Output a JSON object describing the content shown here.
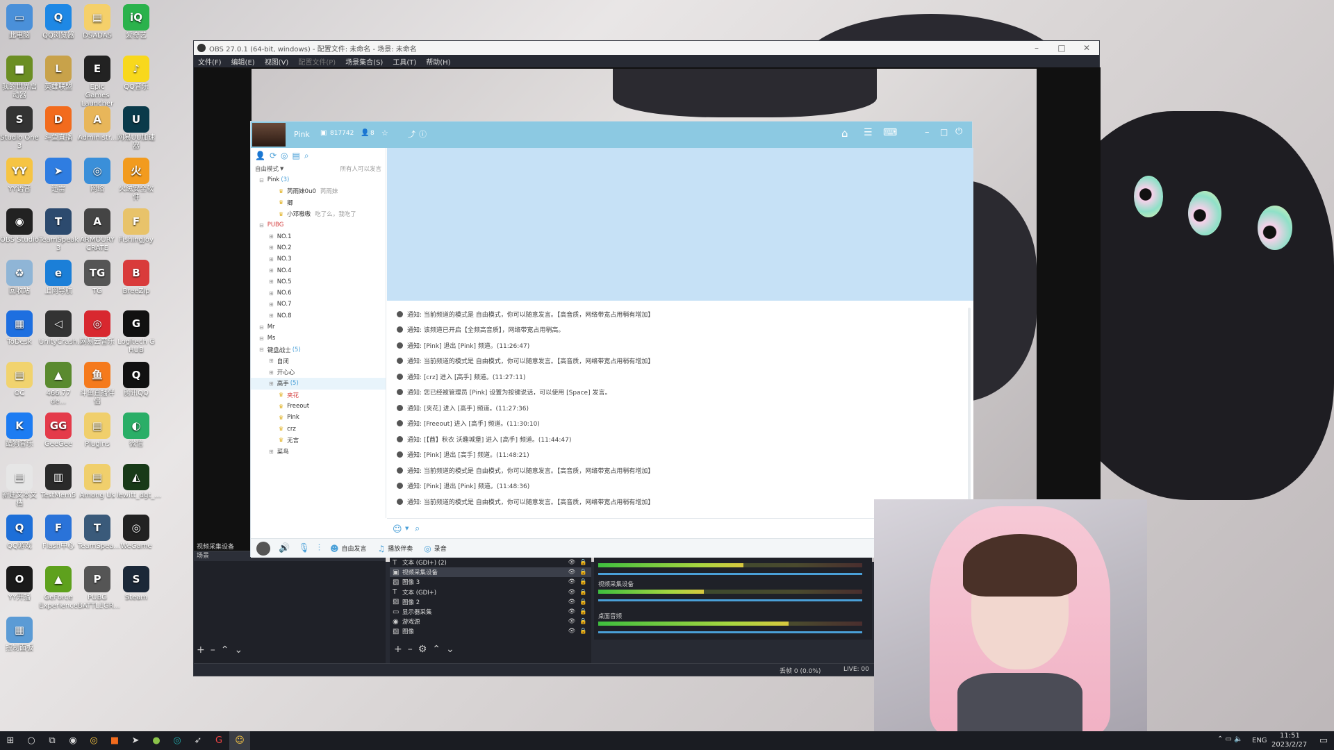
{
  "desktop_icons": [
    {
      "label": "此电脑",
      "color": "#4a90d9",
      "glyph": "▭"
    },
    {
      "label": "QQ浏览器",
      "color": "#1e88e5",
      "glyph": "Q"
    },
    {
      "label": "DSADAS",
      "color": "#f5d06a",
      "glyph": "▤"
    },
    {
      "label": "爱奇艺",
      "color": "#2bb24c",
      "glyph": "iQ"
    },
    {
      "label": "我的世界启动器",
      "color": "#6b8e23",
      "glyph": "■"
    },
    {
      "label": "英雄联盟",
      "color": "#c8a24a",
      "glyph": "L"
    },
    {
      "label": "Epic Games Launcher",
      "color": "#222",
      "glyph": "E"
    },
    {
      "label": "QQ音乐",
      "color": "#f8d81c",
      "glyph": "♪"
    },
    {
      "label": "Studio One 3",
      "color": "#333",
      "glyph": "S"
    },
    {
      "label": "斗鱼直播",
      "color": "#f26b1d",
      "glyph": "D"
    },
    {
      "label": "Administr...",
      "color": "#e8b65a",
      "glyph": "A"
    },
    {
      "label": "网易UU加速器",
      "color": "#0a3a4a",
      "glyph": "U"
    },
    {
      "label": "YY语音",
      "color": "#f6c443",
      "glyph": "YY"
    },
    {
      "label": "迅雷",
      "color": "#2f7de1",
      "glyph": "➤"
    },
    {
      "label": "网络",
      "color": "#3a8fd9",
      "glyph": "◎"
    },
    {
      "label": "火绒安全软件",
      "color": "#f29b1e",
      "glyph": "火"
    },
    {
      "label": "OBS Studio",
      "color": "#222",
      "glyph": "◉"
    },
    {
      "label": "TeamSpeak 3",
      "color": "#2c4a6e",
      "glyph": "T"
    },
    {
      "label": "ARMOURY CRATE",
      "color": "#444",
      "glyph": "A"
    },
    {
      "label": "FishingJoy",
      "color": "#e8c36a",
      "glyph": "F"
    },
    {
      "label": "回收站",
      "color": "#8fb5d6",
      "glyph": "♻"
    },
    {
      "label": "上网导航",
      "color": "#1b7fd8",
      "glyph": "e"
    },
    {
      "label": "TG",
      "color": "#555",
      "glyph": "TG"
    },
    {
      "label": "BreeZip",
      "color": "#d93b3b",
      "glyph": "B"
    },
    {
      "label": "ToDesk",
      "color": "#1e6fe0",
      "glyph": "▦"
    },
    {
      "label": "UnityCrash...",
      "color": "#333",
      "glyph": "◁"
    },
    {
      "label": "网易云音乐",
      "color": "#d8282f",
      "glyph": "◎"
    },
    {
      "label": "Logitech G HUB",
      "color": "#111",
      "glyph": "G"
    },
    {
      "label": "OC",
      "color": "#f1d36e",
      "glyph": "▤"
    },
    {
      "label": "466.77 de...",
      "color": "#5a8a2f",
      "glyph": "▲"
    },
    {
      "label": "斗鱼直播伴侣",
      "color": "#f57a1c",
      "glyph": "鱼"
    },
    {
      "label": "腾讯QQ",
      "color": "#111",
      "glyph": "Q"
    },
    {
      "label": "酷狗音乐",
      "color": "#1d7cf2",
      "glyph": "K"
    },
    {
      "label": "GeeGee",
      "color": "#e43b4a",
      "glyph": "GG"
    },
    {
      "label": "Plugins",
      "color": "#f0cf6c",
      "glyph": "▤"
    },
    {
      "label": "微信",
      "color": "#2aae67",
      "glyph": "◐"
    },
    {
      "label": "新建文本文档",
      "color": "#e6e6e6",
      "glyph": "▤"
    },
    {
      "label": "TestMem5",
      "color": "#2a2a2a",
      "glyph": "▥"
    },
    {
      "label": "Among Us",
      "color": "#f0cf6c",
      "glyph": "▤"
    },
    {
      "label": "lewitt_dgt_...",
      "color": "#183a18",
      "glyph": "◭"
    },
    {
      "label": "QQ游戏",
      "color": "#1d6fd8",
      "glyph": "Q"
    },
    {
      "label": "Flash中心",
      "color": "#2a73d9",
      "glyph": "F"
    },
    {
      "label": "TeamSpea...",
      "color": "#3a5a7a",
      "glyph": "T"
    },
    {
      "label": "WeGame",
      "color": "#222",
      "glyph": "◎"
    },
    {
      "label": "YY开播",
      "color": "#1a1a1a",
      "glyph": "O"
    },
    {
      "label": "GeForce Experience",
      "color": "#5ea11d",
      "glyph": "▲"
    },
    {
      "label": "PUBG BATTLEGR...",
      "color": "#555",
      "glyph": "P"
    },
    {
      "label": "Steam",
      "color": "#1b2838",
      "glyph": "S"
    },
    {
      "label": "控制面板",
      "color": "#5b9bd5",
      "glyph": "▦"
    }
  ],
  "obs": {
    "title": "OBS 27.0.1 (64-bit, windows) - 配置文件: 未命名 - 场景: 未命名",
    "menu": [
      {
        "label": "文件(F)",
        "dim": false
      },
      {
        "label": "编辑(E)",
        "dim": false
      },
      {
        "label": "视图(V)",
        "dim": false
      },
      {
        "label": "配置文件(P)",
        "dim": true
      },
      {
        "label": "场景集合(S)",
        "dim": false
      },
      {
        "label": "工具(T)",
        "dim": false
      },
      {
        "label": "帮助(H)",
        "dim": false
      }
    ],
    "source_label": "视频采集设备",
    "scenes_header": "场景",
    "sources": [
      {
        "icon": "T",
        "label": "文本 (GDI+) (2)"
      },
      {
        "icon": "▣",
        "label": "视频采集设备"
      },
      {
        "icon": "▨",
        "label": "图像 3"
      },
      {
        "icon": "T",
        "label": "文本 (GDI+)"
      },
      {
        "icon": "▨",
        "label": "图像 2"
      },
      {
        "icon": "▭",
        "label": "显示器采集"
      },
      {
        "icon": "◉",
        "label": "游戏源"
      },
      {
        "icon": "▨",
        "label": "图像"
      }
    ],
    "mixer": [
      {
        "name": "视频采集设备",
        "level": 0.4
      },
      {
        "name": "桌面音频",
        "level": 0.72
      }
    ],
    "status": "丢帧 0 (0.0%)",
    "live": "LIVE: 00"
  },
  "yy": {
    "channel_name": "Pink",
    "channel_id": "817742",
    "online": "8",
    "mode": "自由模式",
    "mode_note": "所有人可以发言",
    "tree": [
      {
        "level": 0,
        "text": "Pink",
        "count": "(3)",
        "color": "#333"
      },
      {
        "level": 2,
        "text": "芮雨妹0u0",
        "extra": "芮雨妹",
        "color": "#333"
      },
      {
        "level": 2,
        "text": "卿",
        "extra": "",
        "color": "#333"
      },
      {
        "level": 2,
        "text": "小邓嗷嗷",
        "extra": "吃了么，我吃了",
        "color": "#333"
      },
      {
        "level": 0,
        "text": "PUBG",
        "count": "",
        "color": "#d43c3c"
      },
      {
        "level": 1,
        "text": "NO.1",
        "count": "",
        "color": "#333"
      },
      {
        "level": 1,
        "text": "NO.2",
        "count": "",
        "color": "#333"
      },
      {
        "level": 1,
        "text": "NO.3",
        "count": "",
        "color": "#333"
      },
      {
        "level": 1,
        "text": "NO.4",
        "count": "",
        "color": "#333"
      },
      {
        "level": 1,
        "text": "NO.5",
        "count": "",
        "color": "#333"
      },
      {
        "level": 1,
        "text": "NO.6",
        "count": "",
        "color": "#333"
      },
      {
        "level": 1,
        "text": "NO.7",
        "count": "",
        "color": "#333"
      },
      {
        "level": 1,
        "text": "NO.8",
        "count": "",
        "color": "#333"
      },
      {
        "level": 0,
        "text": "Mr",
        "count": "",
        "color": "#333"
      },
      {
        "level": 0,
        "text": "Ms",
        "count": "",
        "color": "#333"
      },
      {
        "level": 0,
        "text": "键盘战士",
        "count": "(5)",
        "color": "#333"
      },
      {
        "level": 1,
        "text": "自闭",
        "count": "",
        "color": "#333"
      },
      {
        "level": 1,
        "text": "开心心",
        "count": "",
        "color": "#333"
      },
      {
        "level": 1,
        "text": "高手",
        "count": "(5)",
        "color": "#333",
        "selected": true
      },
      {
        "level": 2,
        "text": "夹花",
        "extra": "",
        "color": "#d43c3c"
      },
      {
        "level": 2,
        "text": "Freeout",
        "extra": "",
        "color": "#333"
      },
      {
        "level": 2,
        "text": "Pink",
        "extra": "",
        "color": "#333"
      },
      {
        "level": 2,
        "text": "crz",
        "extra": "",
        "color": "#333"
      },
      {
        "level": 2,
        "text": "无言",
        "extra": "",
        "color": "#333"
      },
      {
        "level": 1,
        "text": "菜鸟",
        "count": "",
        "color": "#333"
      }
    ],
    "messages": [
      "通知: 当前频道的模式是 自由模式，你可以随意发言。【高音质，网络带宽占用稍有增加】",
      "通知: 该频道已开启【全频高音质】，网络带宽占用稍高。",
      "通知: [Pink] 退出 [Pink] 频道。(11:26:47)",
      "通知: 当前频道的模式是 自由模式，你可以随意发言。【高音质，网络带宽占用稍有增加】",
      "通知: [crz] 进入 [高手] 频道。(11:27:11)",
      "通知: 您已经被管理员 [Pink] 设置为按键说话，可以使用 [Space] 发言。",
      "通知: [夹花] 进入 [高手] 频道。(11:27:36)",
      "通知: [Freeout] 进入 [高手] 频道。(11:30:10)",
      "通知: [【酋】秋衣 沃趣城堡] 进入 [高手] 频道。(11:44:47)",
      "通知: [Pink] 退出 [高手] 频道。(11:48:21)",
      "通知: 当前频道的模式是 自由模式，你可以随意发言。【高音质，网络带宽占用稍有增加】",
      "通知: [Pink] 退出 [Pink] 频道。(11:48:36)",
      "通知: 当前频道的模式是 自由模式，你可以随意发言。【高音质，网络带宽占用稍有增加】"
    ],
    "bottom": {
      "free_speak": "自由发言",
      "accompany": "播放伴奏",
      "record": "录音"
    }
  },
  "taskbar": {
    "lang": "ENG",
    "time": "11:51",
    "date": "2023/2/27"
  }
}
